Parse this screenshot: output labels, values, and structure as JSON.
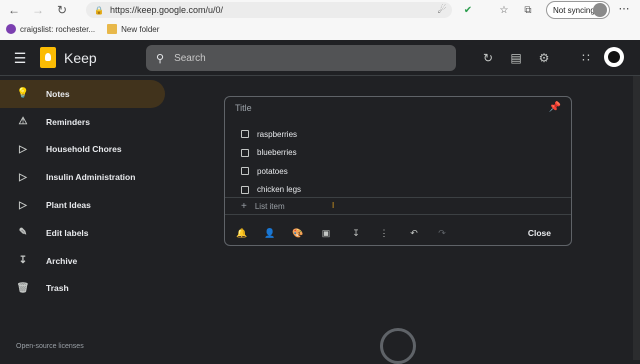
{
  "browser": {
    "url": "https://keep.google.com/u/0/",
    "sync_label": "Not syncing",
    "bookmarks": [
      {
        "label": "craigslist: rochester..."
      },
      {
        "label": "New folder"
      }
    ]
  },
  "header": {
    "app_title": "Keep",
    "search_placeholder": "Search"
  },
  "sidebar": {
    "items": [
      {
        "label": "Notes",
        "icon": "lightbulb-icon"
      },
      {
        "label": "Reminders",
        "icon": "bell-icon"
      },
      {
        "label": "Household Chores",
        "icon": "label-icon"
      },
      {
        "label": "Insulin Administration",
        "icon": "label-icon"
      },
      {
        "label": "Plant Ideas",
        "icon": "label-icon"
      },
      {
        "label": "Edit labels",
        "icon": "pencil-icon"
      },
      {
        "label": "Archive",
        "icon": "archive-icon"
      },
      {
        "label": "Trash",
        "icon": "trash-icon"
      }
    ],
    "footer_link": "Open-source licenses"
  },
  "note": {
    "title_placeholder": "Title",
    "items": [
      {
        "text": "raspberries",
        "checked": false
      },
      {
        "text": "blueberries",
        "checked": false
      },
      {
        "text": "potatoes",
        "checked": false
      },
      {
        "text": "chicken legs",
        "checked": false
      }
    ],
    "add_item_placeholder": "List item",
    "close_label": "Close"
  },
  "colors": {
    "background": "#202124",
    "active_item": "#41331c",
    "logo": "#fbbc04"
  }
}
